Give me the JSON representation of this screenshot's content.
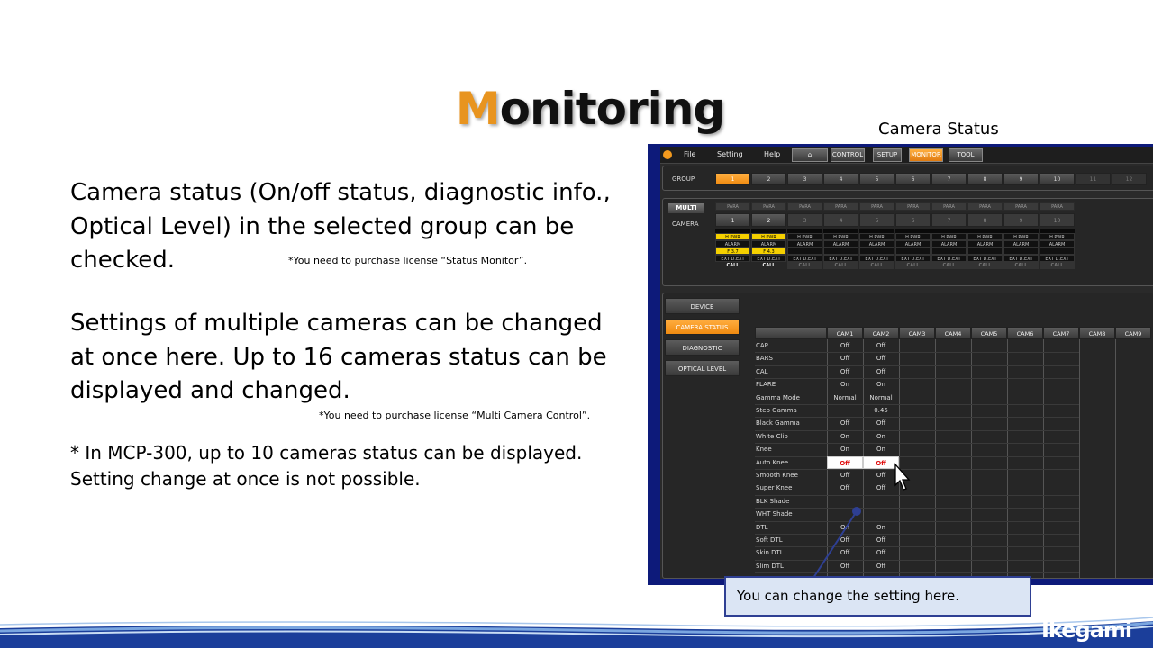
{
  "slide": {
    "title_first_letter": "M",
    "title_rest": "onitoring",
    "camera_status_caption": "Camera Status",
    "paragraph1": "Camera status (On/off status, diagnostic info., Optical Level) in the selected group can be checked.",
    "note1": "*You need to purchase license “Status Monitor”.",
    "paragraph2": "Settings of multiple cameras can be changed at once here. Up to 16 cameras status can be displayed and changed.",
    "note2": "*You need to purchase license “Multi Camera Control”.",
    "paragraph3_line1": "* In MCP-300, up to 10 cameras status can be displayed.",
    "paragraph3_line2": "Setting change at once is not possible.",
    "callout": "You can change the setting here.",
    "brand": "Ikegami"
  },
  "app": {
    "menu": [
      "File",
      "Setting",
      "Help"
    ],
    "nav": [
      "CONTROL",
      "SETUP",
      "MONITOR",
      "TOOL"
    ],
    "nav_active": "MONITOR",
    "group_label": "GROUP",
    "groups": [
      "1",
      "2",
      "3",
      "4",
      "5",
      "6",
      "7",
      "8",
      "9",
      "10",
      "11",
      "12"
    ],
    "multi_label": "MULTI",
    "camera_label": "CAMERA",
    "para_label": "PARA",
    "cameras": [
      "1",
      "2",
      "3",
      "4",
      "5",
      "6",
      "7",
      "8",
      "9",
      "10"
    ],
    "hpwr": "H.PWR",
    "alarm": "ALARM",
    "fstops": [
      "F 3.7",
      "F 4.3"
    ],
    "ext": "EXT",
    "dext": "D.EXT",
    "call": "CALL",
    "side_buttons": [
      "DEVICE",
      "CAMERA STATUS",
      "DIAGNOSTIC",
      "OPTICAL LEVEL"
    ],
    "side_active": "CAMERA STATUS",
    "columns": [
      "CAM1",
      "CAM2",
      "CAM3",
      "CAM4",
      "CAM5",
      "CAM6",
      "CAM7",
      "CAM8",
      "CAM9"
    ],
    "rows": [
      {
        "label": "CAP",
        "cam1": "Off",
        "cam2": "Off"
      },
      {
        "label": "BARS",
        "cam1": "Off",
        "cam2": "Off"
      },
      {
        "label": "CAL",
        "cam1": "Off",
        "cam2": "Off"
      },
      {
        "label": "FLARE",
        "cam1": "On",
        "cam2": "On"
      },
      {
        "label": "Gamma Mode",
        "cam1": "Normal",
        "cam2": "Normal"
      },
      {
        "label": "Step Gamma",
        "cam1": "",
        "cam2": "0.45"
      },
      {
        "label": "Black Gamma",
        "cam1": "Off",
        "cam2": "Off"
      },
      {
        "label": "White Clip",
        "cam1": "On",
        "cam2": "On"
      },
      {
        "label": "Knee",
        "cam1": "On",
        "cam2": "On"
      },
      {
        "label": "Auto Knee",
        "cam1": "Off",
        "cam2": "Off"
      },
      {
        "label": "Smooth Knee",
        "cam1": "Off",
        "cam2": "Off"
      },
      {
        "label": "Super Knee",
        "cam1": "Off",
        "cam2": "Off"
      },
      {
        "label": "BLK Shade",
        "cam1": "",
        "cam2": ""
      },
      {
        "label": "WHT Shade",
        "cam1": "",
        "cam2": ""
      },
      {
        "label": "DTL",
        "cam1": "On",
        "cam2": "On"
      },
      {
        "label": "Soft DTL",
        "cam1": "Off",
        "cam2": "Off"
      },
      {
        "label": "Skin DTL",
        "cam1": "Off",
        "cam2": "Off"
      },
      {
        "label": "Slim DTL",
        "cam1": "Off",
        "cam2": "Off"
      }
    ],
    "highlight_row": "Auto Knee"
  }
}
